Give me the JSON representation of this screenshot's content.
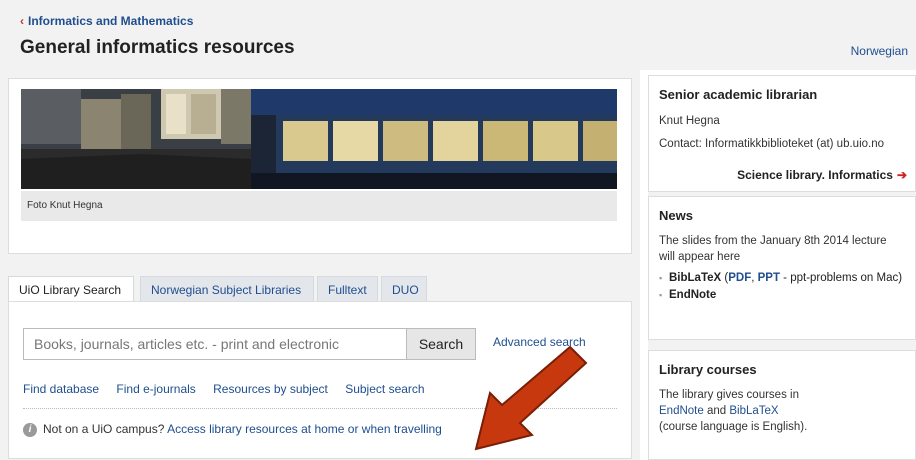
{
  "header": {
    "breadcrumb": "Informatics and Mathematics",
    "title": "General informatics resources",
    "language_link": "Norwegian"
  },
  "photo": {
    "caption": "Foto Knut Hegna"
  },
  "tabs": [
    {
      "label": "UiO Library Search",
      "active": true
    },
    {
      "label": "Norwegian Subject Libraries",
      "active": false
    },
    {
      "label": "Fulltext",
      "active": false
    },
    {
      "label": "DUO",
      "active": false
    }
  ],
  "search": {
    "placeholder": "Books, journals, articles etc. - print and electronic",
    "button": "Search",
    "advanced": "Advanced search",
    "links": [
      "Find database",
      "Find e-journals",
      "Resources by subject",
      "Subject search"
    ],
    "info_prefix": "Not on a UiO campus?",
    "info_link": "Access library resources at home or when travelling"
  },
  "librarian": {
    "heading": "Senior academic librarian",
    "name": "Knut Hegna",
    "contact": "Contact: Informatikkbiblioteket (at) ub.uio.no",
    "library_link": "Science library. Informatics"
  },
  "news": {
    "heading": "News",
    "text": "The slides from the January 8th 2014 lecture will appear here",
    "items": [
      {
        "bold": "BibLaTeX",
        "l1": "PDF",
        "l2": "PPT",
        "rest": " - ppt-problems on Mac)"
      },
      {
        "bold": "EndNote"
      }
    ]
  },
  "courses": {
    "heading": "Library courses",
    "line1": "The library gives courses in",
    "link1": "EndNote",
    "and": " and ",
    "link2": "BibLaTeX",
    "line3": "(course language is English)."
  },
  "colors": {
    "link": "#1f4e8f",
    "arrow": "#c8380f",
    "accent": "#d02020"
  }
}
